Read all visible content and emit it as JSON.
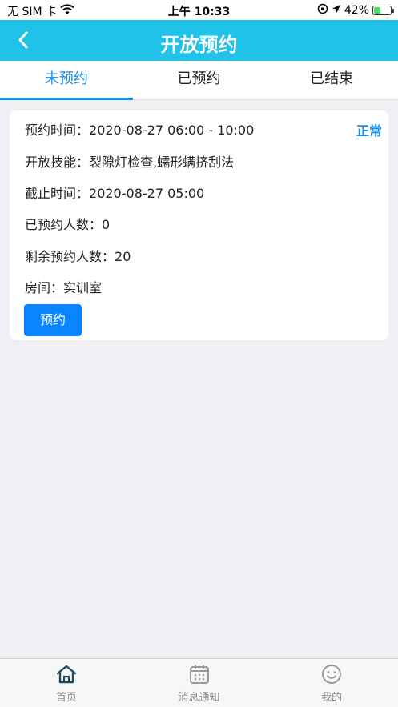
{
  "statusbar": {
    "carrier": "无 SIM 卡",
    "time": "上午 10:33",
    "battery": "42%",
    "battery_level": 0.42
  },
  "navbar": {
    "title": "开放预约"
  },
  "tabs": [
    {
      "label": "未预约",
      "active": true
    },
    {
      "label": "已预约",
      "active": false
    },
    {
      "label": "已结束",
      "active": false
    }
  ],
  "card": {
    "status": "正常",
    "rows": [
      {
        "label": "预约时间：",
        "value": "2020-08-27 06:00 - 10:00"
      },
      {
        "label": "开放技能：",
        "value": "裂隙灯检查,蠕形螨挤刮法"
      },
      {
        "label": "截止时间：",
        "value": "2020-08-27 05:00"
      },
      {
        "label": "已预约人数：",
        "value": "0"
      },
      {
        "label": "剩余预约人数：",
        "value": "20"
      },
      {
        "label": "房间：",
        "value": "实训室"
      }
    ],
    "button_label": "预约"
  },
  "bottom_nav": [
    {
      "label": "首页",
      "icon": "home-icon"
    },
    {
      "label": "消息通知",
      "icon": "calendar-icon"
    },
    {
      "label": "我的",
      "icon": "smiley-icon"
    }
  ],
  "colors": {
    "navbar": "#1fc2e8",
    "accent": "#1a8fe8",
    "button": "#0a84ff",
    "background": "#efeff4"
  }
}
